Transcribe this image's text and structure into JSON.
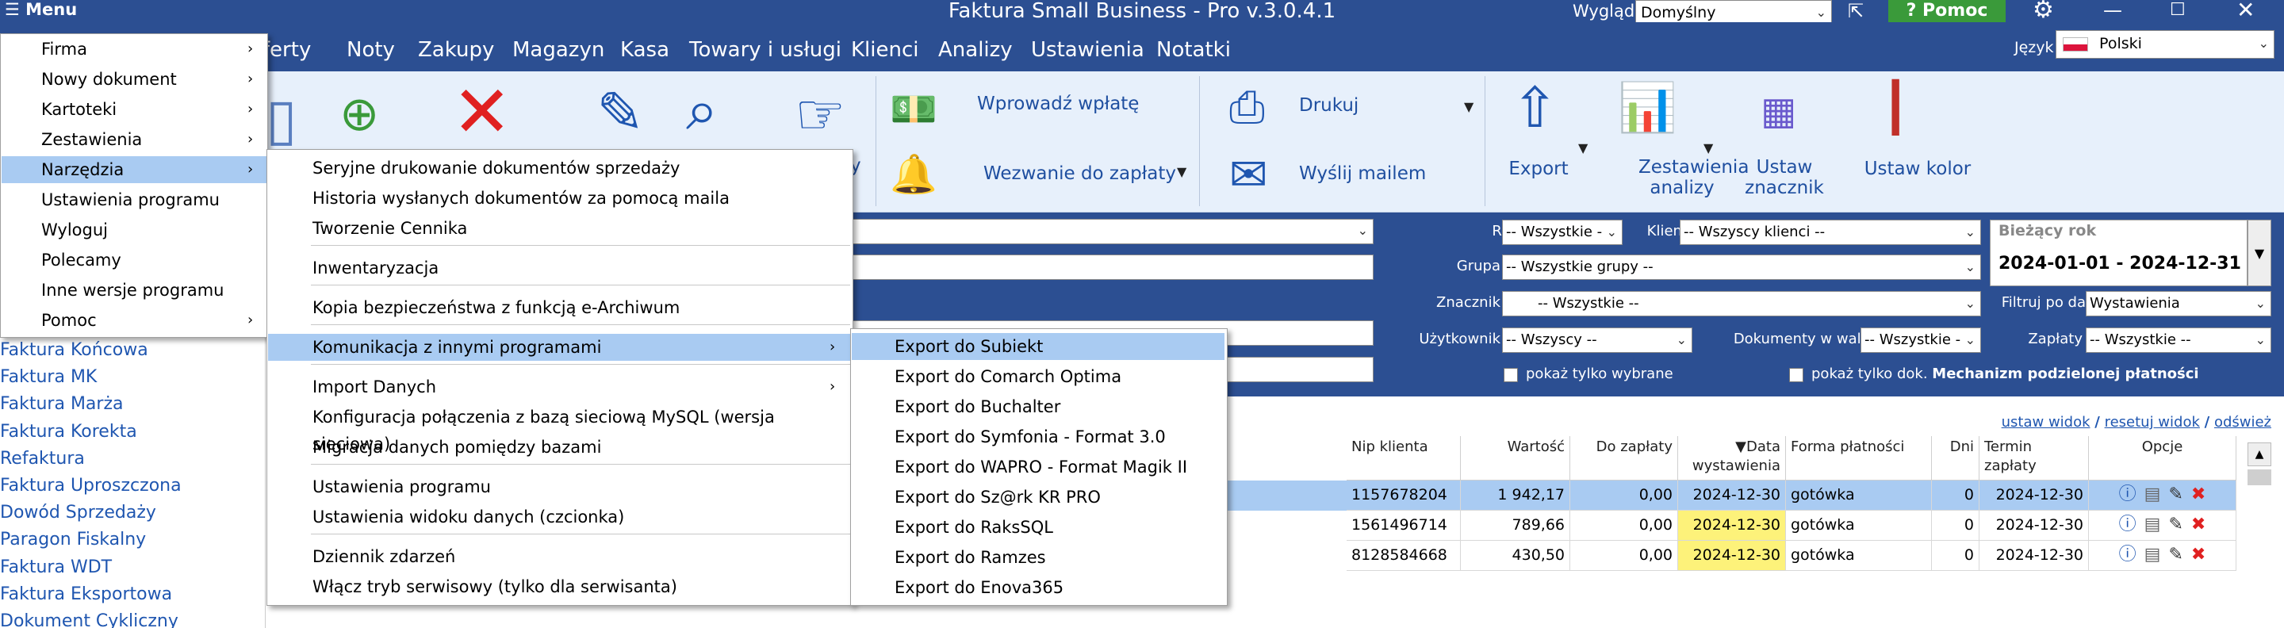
{
  "window": {
    "title": "Faktura Small Business - Pro v.3.0.4.1",
    "menu_button": "Menu",
    "look_label": "Wygląd",
    "look_value": "Domyślny",
    "help_label": "Pomoc",
    "pin_icon": "pin-icon",
    "settings_icon": "gear-icon"
  },
  "menubar": {
    "items": [
      "oferty",
      "Noty",
      "Zakupy",
      "Magazyn",
      "Kasa",
      "Towary i usługi",
      "Klienci",
      "Analizy",
      "Ustawienia",
      "Notatki"
    ],
    "language_label": "Język",
    "language_value": "Polski"
  },
  "toolbar": {
    "payment_label": "Wprowadź wpłatę",
    "reminder_label": "Wezwanie do zapłaty",
    "print_label": "Drukuj",
    "mail_label": "Wyślij mailem",
    "export_label": "Export",
    "reports_label": "Zestawienia\nanalizy",
    "tag_label": "Ustaw\nznacznik",
    "color_label": "Ustaw kolor",
    "partial_y": "y"
  },
  "filter": {
    "register_label": "Rejestr",
    "register_value": "-- Wszystkie -",
    "client_label": "Klient",
    "client_value": "-- Wszyscy klienci --",
    "group_label": "Grupa",
    "group_value": "-- Wszystkie grupy --",
    "tag_label": "Znacznik",
    "tag_value": "-- Wszystkie --",
    "user_label": "Użytkownik",
    "user_value": "-- Wszyscy --",
    "currency_label": "Dokumenty w walucie",
    "currency_value": "-- Wszystkie -",
    "payments_label": "Zapłaty",
    "payments_value": "-- Wszystkie --",
    "date_filter_label": "Filtruj po dacie",
    "date_filter_value": "Wystawienia",
    "year_label": "Bieżący rok",
    "year_range": "2024-01-01  -  2024-12-31",
    "only_selected": "pokaż tylko wybrane",
    "only_docs": "pokaż tylko dok.",
    "split_payment": "Mechanizm podzielonej płatności"
  },
  "links": {
    "set_view": "ustaw widok",
    "reset_view": "resetuj widok",
    "refresh": "odśwież",
    "sep": "/"
  },
  "grid": {
    "headers": [
      "Nip klienta",
      "Wartość",
      "Do zapłaty",
      "▼Data\nwystawienia",
      "Forma płatności",
      "Dni",
      "Termin zapłaty",
      "Opcje"
    ],
    "rows": [
      [
        "1157678204",
        "1 942,17",
        "0,00",
        "2024-12-30",
        "gotówka",
        "0",
        "2024-12-30"
      ],
      [
        "1561496714",
        "789,66",
        "0,00",
        "2024-12-30",
        "gotówka",
        "0",
        "2024-12-30"
      ],
      [
        "8128584668",
        "430,50",
        "0,00",
        "2024-12-30",
        "gotówka",
        "0",
        "2024-12-30"
      ]
    ]
  },
  "left_list": [
    "Faktura Końcowa",
    "Faktura MK",
    "Faktura Marża",
    "Faktura Korekta",
    "Refaktura",
    "Faktura Uproszczona",
    "Dowód Sprzedaży",
    "Paragon Fiskalny",
    "Faktura WDT",
    "Faktura Eksportowa",
    "Dokument Cykliczny"
  ],
  "main_menu": {
    "items": [
      "Firma",
      "Nowy dokument",
      "Kartoteki",
      "Zestawienia",
      "Narzędzia",
      "Ustawienia programu",
      "Wyloguj",
      "Polecamy",
      "Inne wersje programu",
      "Pomoc"
    ]
  },
  "tools_menu": {
    "items": [
      "Seryjne drukowanie dokumentów sprzedaży",
      "Historia wysłanych dokumentów za pomocą maila",
      "Tworzenie Cennika",
      "Inwentaryzacja",
      "Kopia bezpieczeństwa z funkcją e-Archiwum",
      "Komunikacja z innymi programami",
      "Import Danych",
      "Konfiguracja połączenia z bazą sieciową MySQL (wersja sieciowa)",
      "Migracja danych pomiędzy bazami",
      "Ustawienia programu",
      "Ustawienia widoku danych (czcionka)",
      "Dziennik zdarzeń",
      "Włącz tryb serwisowy (tylko dla serwisanta)"
    ]
  },
  "export_menu": {
    "items": [
      "Export do Subiekt",
      "Export do Comarch Optima",
      "Export do Buchalter",
      "Export do Symfonia - Format 3.0",
      "Export do WAPRO - Format Magik II",
      "Export do Sz@rk KR PRO",
      "Export do RaksSQL",
      "Export do Ramzes",
      "Export do Enova365"
    ]
  },
  "colors": {
    "title_bar": "#2c4f92",
    "accent": "#1f56b0",
    "selection": "#a9cbf2",
    "highlight": "#fdf27a"
  }
}
